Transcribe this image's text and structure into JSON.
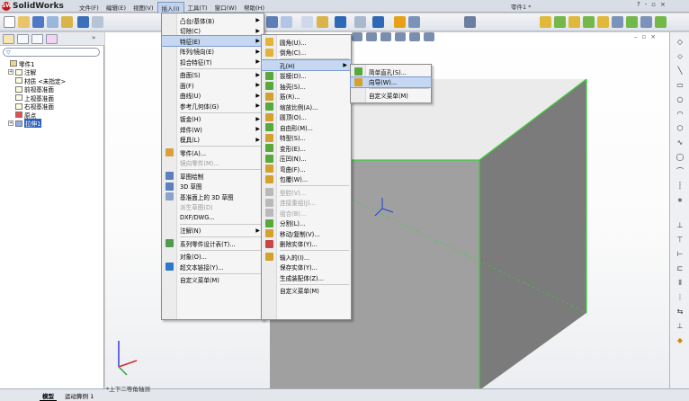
{
  "app": {
    "name": "SolidWorks",
    "document_title": "零件1 *",
    "window_controls": [
      "?",
      "-",
      "▫",
      "×"
    ]
  },
  "menubar": [
    {
      "label": "文件(F)"
    },
    {
      "label": "编辑(E)"
    },
    {
      "label": "视图(V)"
    },
    {
      "label": "插入(I)",
      "active": true
    },
    {
      "label": "工具(T)"
    },
    {
      "label": "窗口(W)"
    },
    {
      "label": "帮助(H)"
    }
  ],
  "feature_tree": {
    "items": [
      {
        "label": "零件1",
        "indent": 0
      },
      {
        "label": "注解",
        "indent": 1
      },
      {
        "label": "材质 <未指定>",
        "indent": 1
      },
      {
        "label": "前视基准面",
        "indent": 1
      },
      {
        "label": "上视基准面",
        "indent": 1
      },
      {
        "label": "右视基准面",
        "indent": 1
      },
      {
        "label": "原点",
        "indent": 1
      },
      {
        "label": "拉伸1",
        "indent": 1,
        "selected": true
      }
    ]
  },
  "insert_menu": {
    "items": [
      {
        "label": "凸台/基体(B)",
        "submenu": true,
        "icon": "none"
      },
      {
        "label": "切除(C)",
        "submenu": true,
        "icon": "none"
      },
      {
        "label": "特征(E)",
        "submenu": true,
        "highlight": true,
        "icon": "none"
      },
      {
        "label": "阵列/镜向(E)",
        "submenu": true,
        "icon": "none"
      },
      {
        "label": "扣合特征(T)",
        "submenu": true,
        "icon": "none"
      },
      {
        "sep": true
      },
      {
        "label": "曲面(S)",
        "submenu": true,
        "icon": "none"
      },
      {
        "label": "面(F)",
        "submenu": true,
        "icon": "none"
      },
      {
        "label": "曲线(U)",
        "submenu": true,
        "icon": "none"
      },
      {
        "label": "参考几何体(G)",
        "submenu": true,
        "icon": "none"
      },
      {
        "sep": true
      },
      {
        "label": "钣金(H)",
        "submenu": true,
        "icon": "none"
      },
      {
        "label": "焊件(W)",
        "submenu": true,
        "icon": "none"
      },
      {
        "label": "模具(L)",
        "submenu": true,
        "icon": "none"
      },
      {
        "sep": true
      },
      {
        "label": "零件(A)...",
        "icon": "part-icon"
      },
      {
        "label": "镜向零件(M)...",
        "disabled": true,
        "icon": "none"
      },
      {
        "sep": true
      },
      {
        "label": "草图绘制",
        "icon": "sketch-icon"
      },
      {
        "label": "3D 草图",
        "icon": "3d-sketch-icon"
      },
      {
        "label": "基准面上的 3D 草图",
        "icon": "plane-sketch-icon"
      },
      {
        "label": "派生草图(D)",
        "disabled": true,
        "icon": "none"
      },
      {
        "label": "DXF/DWG...",
        "icon": "none"
      },
      {
        "sep": true
      },
      {
        "label": "注解(N)",
        "submenu": true,
        "icon": "none"
      },
      {
        "sep": true
      },
      {
        "label": "系列零件设计表(T)...",
        "icon": "table-icon"
      },
      {
        "sep": true
      },
      {
        "label": "对象(O)...",
        "icon": "none"
      },
      {
        "label": "超文本链接(Y)...",
        "icon": "hyperlink-icon"
      },
      {
        "sep": true
      },
      {
        "label": "自定义菜单(M)",
        "icon": "none"
      }
    ]
  },
  "feature_menu": {
    "items": [
      {
        "label": "圆角(U)...",
        "icon": "fillet-icon"
      },
      {
        "label": "倒角(C)...",
        "icon": "chamfer-icon"
      },
      {
        "sep": true
      },
      {
        "label": "孔(H)",
        "submenu": true,
        "highlight": true,
        "icon": "none"
      },
      {
        "label": "拔模(D)...",
        "icon": "draft-icon"
      },
      {
        "label": "抽壳(S)...",
        "icon": "shell-icon"
      },
      {
        "label": "筋(R)...",
        "icon": "rib-icon"
      },
      {
        "label": "缩放比例(A)...",
        "icon": "scale-icon"
      },
      {
        "label": "圆顶(O)...",
        "icon": "dome-icon"
      },
      {
        "label": "自由形(M)...",
        "icon": "freeform-icon"
      },
      {
        "label": "特型(S)...",
        "icon": "shape-icon"
      },
      {
        "label": "变形(E)...",
        "icon": "deform-icon"
      },
      {
        "label": "压凹(N)...",
        "icon": "indent-icon"
      },
      {
        "label": "弯曲(F)...",
        "icon": "flex-icon"
      },
      {
        "label": "包覆(W)...",
        "icon": "wrap-icon"
      },
      {
        "sep": true
      },
      {
        "label": "型腔(V)...",
        "disabled": true,
        "icon": "cavity-icon"
      },
      {
        "label": "连接重组(J)...",
        "disabled": true,
        "icon": "join-icon"
      },
      {
        "label": "组合(B)...",
        "disabled": true,
        "icon": "combine-icon"
      },
      {
        "label": "分割(L)...",
        "icon": "split-icon"
      },
      {
        "label": "移动/复制(V)...",
        "icon": "move-icon"
      },
      {
        "label": "删除实体(Y)...",
        "icon": "delete-body-icon"
      },
      {
        "sep": true
      },
      {
        "label": "输入的(I)...",
        "icon": "import-icon"
      },
      {
        "label": "保存实体(Y)...",
        "icon": "none"
      },
      {
        "label": "生成装配体(Z)...",
        "icon": "none"
      },
      {
        "sep": true
      },
      {
        "label": "自定义菜单(M)",
        "icon": "none"
      }
    ]
  },
  "hole_menu": {
    "items": [
      {
        "label": "简单直孔(S)...",
        "icon": "simple-hole-icon"
      },
      {
        "label": "向导(W)...",
        "highlight": true,
        "icon": "hole-wizard-icon"
      },
      {
        "sep": true
      },
      {
        "label": "自定义菜单(M)",
        "icon": "none"
      }
    ]
  },
  "bottom": {
    "view_name": "*上下二等角轴测",
    "tabs": [
      "模型",
      "运动算例 1"
    ]
  },
  "colors": {
    "accent": "#2b5fb7",
    "menu_highlight": "#c5d7f1",
    "edge_green": "#3ad13a",
    "part_gray": "#8c8c8c"
  }
}
